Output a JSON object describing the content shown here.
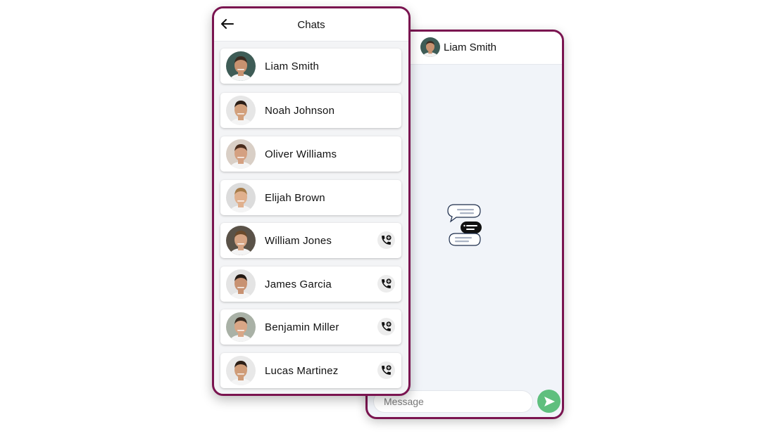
{
  "chat_list": {
    "title": "Chats",
    "back_icon": "arrow-left-icon",
    "contacts": [
      {
        "name": "Liam Smith",
        "has_call_button": false,
        "avatar_bg": "#3e5c56",
        "skin": "#c89270",
        "hair": "#3a2a20"
      },
      {
        "name": "Noah Johnson",
        "has_call_button": false,
        "avatar_bg": "#e6e6e6",
        "skin": "#d2a07c",
        "hair": "#2a1d16"
      },
      {
        "name": "Oliver Williams",
        "has_call_button": false,
        "avatar_bg": "#d9cfc6",
        "skin": "#d4a081",
        "hair": "#4a2c1c"
      },
      {
        "name": "Elijah Brown",
        "has_call_button": false,
        "avatar_bg": "#dcdcdc",
        "skin": "#e0b08d",
        "hair": "#a57b48"
      },
      {
        "name": "William Jones",
        "has_call_button": true,
        "avatar_bg": "#5a5248",
        "skin": "#d6a484",
        "hair": "#6b4a2c"
      },
      {
        "name": "James Garcia",
        "has_call_button": true,
        "avatar_bg": "#e4e4e4",
        "skin": "#c89272",
        "hair": "#241a14"
      },
      {
        "name": "Benjamin Miller",
        "has_call_button": true,
        "avatar_bg": "#a9b1a6",
        "skin": "#d9a686",
        "hair": "#3b2d22"
      },
      {
        "name": "Lucas Martinez",
        "has_call_button": true,
        "avatar_bg": "#e8e8e8",
        "skin": "#cf9c78",
        "hair": "#2b1e16"
      }
    ],
    "call_icon": "phone-add-icon"
  },
  "chat_detail": {
    "contact_name": "Liam Smith",
    "empty_state_icon": "chat-bubbles-icon",
    "message_placeholder": "Message",
    "send_icon": "send-icon"
  },
  "colors": {
    "frame_border": "#7a1450",
    "send_button": "#5fbf7e",
    "chat_background": "#f1f4f9"
  }
}
